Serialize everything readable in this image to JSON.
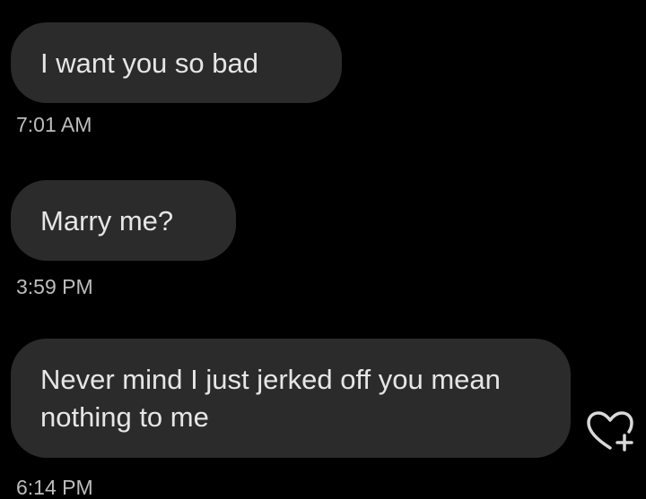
{
  "messages": [
    {
      "text": "I want you so bad",
      "time": "7:01 AM"
    },
    {
      "text": "Marry me?",
      "time": "3:59 PM"
    },
    {
      "text": "Never mind I just jerked off you mean nothing to me",
      "time": "6:14 PM"
    }
  ],
  "icons": {
    "react": "heart-plus-icon"
  },
  "colors": {
    "background": "#000000",
    "bubble": "#2b2b2b",
    "bubble_text": "#e6e6e6",
    "timestamp_text": "#bdbdbd"
  }
}
